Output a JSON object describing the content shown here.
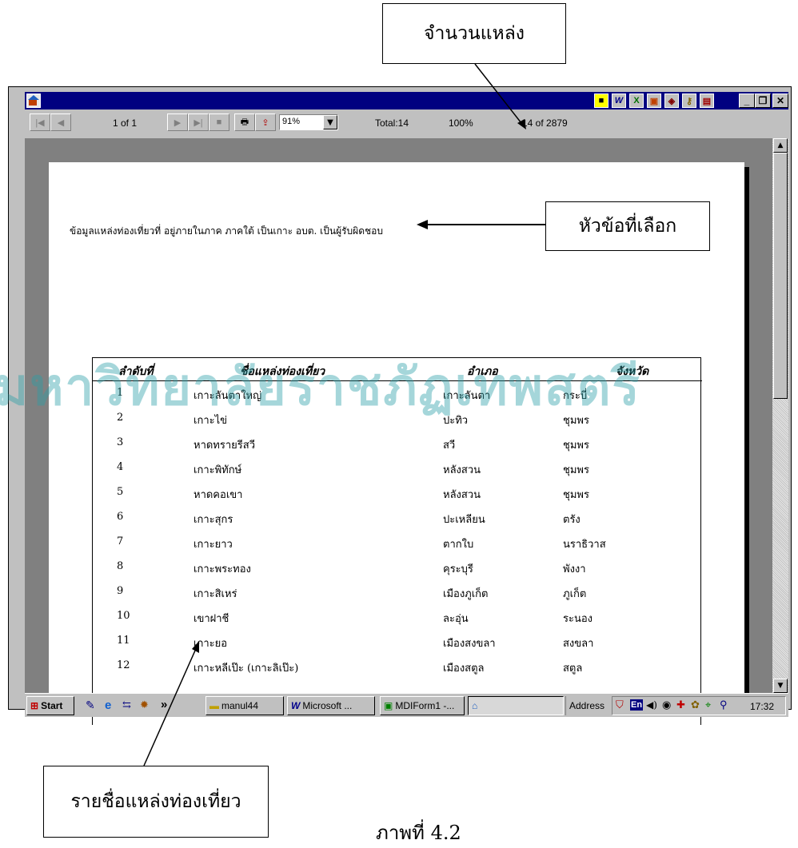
{
  "callouts": {
    "record_count_label": "จำนวนแหล่ง",
    "selected_topic_label": "หัวข้อที่เลือก",
    "attraction_list_label": "รายชื่อแหล่งท่องเที่ยว"
  },
  "toolbar": {
    "page_indicator": "1 of 1",
    "zoom_value": "91%",
    "total_label": "Total:14",
    "percent_label": "100%",
    "record_indicator": "14 of 2879"
  },
  "report": {
    "header_text": "ข้อมูลแหล่งท่องเที่ยวที่  อยู่ภายในภาค ภาคใต้  เป็นเกาะ    อบต. เป็นผู้รับผิดชอบ",
    "columns": [
      "ลำดับที่",
      "ชื่อแหล่งท่องเที่ยว",
      "อำเภอ",
      "จังหวัด"
    ],
    "rows": [
      [
        "1",
        "เกาะลันตาใหญ่",
        "เกาะลันตา",
        "กระบี่"
      ],
      [
        "2",
        "เกาะไข่",
        "ปะทิว",
        "ชุมพร"
      ],
      [
        "3",
        "หาดทรายรีสวี",
        "สวี",
        "ชุมพร"
      ],
      [
        "4",
        "เกาะพิทักษ์",
        "หลังสวน",
        "ชุมพร"
      ],
      [
        "5",
        "หาดคอเขา",
        "หลังสวน",
        "ชุมพร"
      ],
      [
        "6",
        "เกาะสุกร",
        "ปะเหลียน",
        "ตรัง"
      ],
      [
        "7",
        "เกาะยาว",
        "ตากใบ",
        "นราธิวาส"
      ],
      [
        "8",
        "เกาะพระทอง",
        "คุระบุรี",
        "พังงา"
      ],
      [
        "9",
        "เกาะสิเหร่",
        "เมืองภูเก็ต",
        "ภูเก็ต"
      ],
      [
        "10",
        "เขาฝาชี",
        "ละอุ่น",
        "ระนอง"
      ],
      [
        "11",
        "เกาะยอ",
        "เมืองสงขลา",
        "สงขลา"
      ],
      [
        "12",
        "เกาะหลีเป๊ะ (เกาะลิเป๊ะ)",
        "เมืองสตูล",
        "สตูล"
      ]
    ]
  },
  "taskbar": {
    "start_label": "Start",
    "chevron": "»",
    "folder_label": "manul44",
    "word_label": "Microsoft ...",
    "mdi_label": "MDIForm1 -...",
    "address_label": "Address",
    "en_indicator": "En",
    "clock": "17:32"
  },
  "watermark_text": "มหาวิทยาลัยราชภัฏเทพสตรี",
  "caption_fragment": "ภาพที่ 4.2",
  "icons": {
    "title_app": "app-icon",
    "first": "first-page-icon",
    "prev": "prev-page-icon",
    "next": "next-page-icon",
    "last": "last-page-icon",
    "stop": "stop-icon",
    "print": "print-icon",
    "export": "export-icon"
  },
  "colors": {
    "titlebar": "#000080",
    "window_bg": "#c0c0c0",
    "viewer_bg": "#808080",
    "watermark": "#2aa0a8"
  }
}
